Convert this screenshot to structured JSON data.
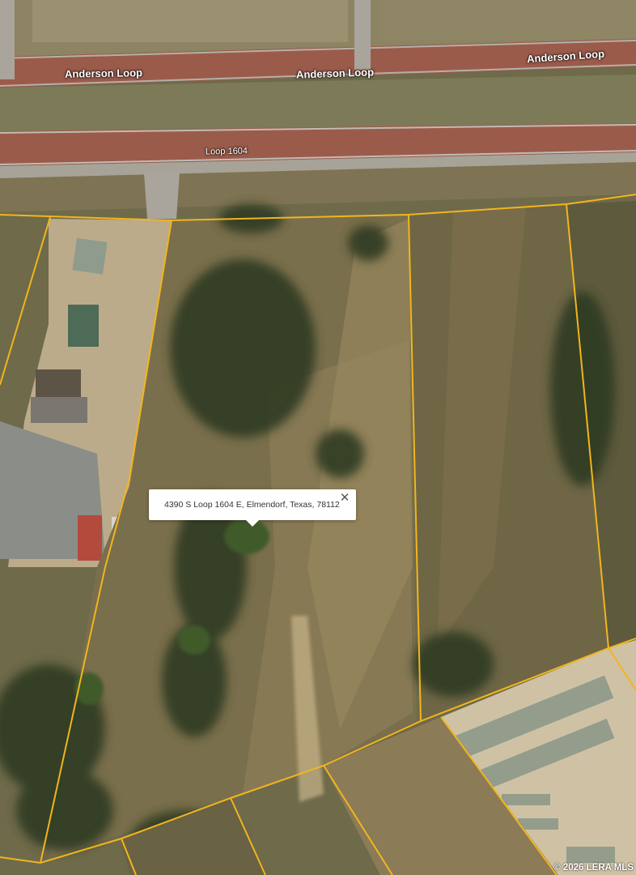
{
  "map": {
    "type": "satellite",
    "parcel_line_color": "#f2b51c",
    "road_color": "#9c5a4a"
  },
  "road_labels": {
    "anderson_loop_1": "Anderson Loop",
    "anderson_loop_2": "Anderson Loop",
    "anderson_loop_3": "Anderson Loop",
    "loop_1604": "Loop 1604"
  },
  "popup": {
    "address": "4390 S Loop 1604 E, Elmendorf, Texas, 78112",
    "close_icon": "close-icon"
  },
  "copyright": "2026 LERA MLS"
}
